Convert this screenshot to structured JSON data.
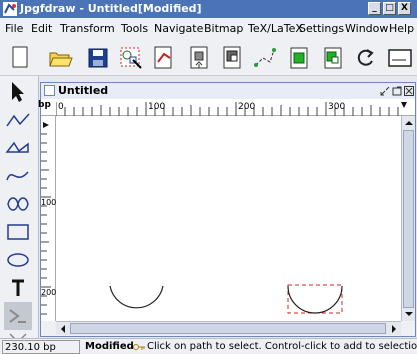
{
  "window": {
    "title": "Jpgfdraw - Untitled[Modified]",
    "controls": [
      "_",
      "□",
      "X"
    ]
  },
  "menu": [
    "File",
    "Edit",
    "Transform",
    "Tools",
    "Navigate",
    "Bitmap",
    "TeX/LaTeX",
    "Settings",
    "Window",
    "Help"
  ],
  "toolbar": {
    "buttons": [
      "new-icon",
      "open-icon",
      "save-icon",
      "select-all-icon",
      "edit-path-icon",
      "move-to-front-icon",
      "move-to-back-icon",
      "grid-snap-icon",
      "group-icon",
      "ungroup-icon",
      "redo-icon",
      "panel-icon"
    ]
  },
  "palette": {
    "tools": [
      "select-icon",
      "open-line-icon",
      "closed-line-icon",
      "open-curve-icon",
      "closed-curve-icon",
      "rectangle-icon",
      "ellipse-icon",
      "text-icon",
      "math-text-icon",
      "close-tool-icon"
    ]
  },
  "document": {
    "title": "Untitled",
    "unit": "bp",
    "h_ticks": [
      "0",
      "100",
      "200",
      "300"
    ],
    "v_ticks": [
      "100",
      "200"
    ]
  },
  "status": {
    "coordinate": "230.10 bp",
    "modified": "Modified",
    "message": "Click on path to select. Control-click to add to selection. Double"
  },
  "colors": {
    "titlebar": "#4a73b8",
    "selection": "#d22",
    "background": "#eef0f4"
  }
}
